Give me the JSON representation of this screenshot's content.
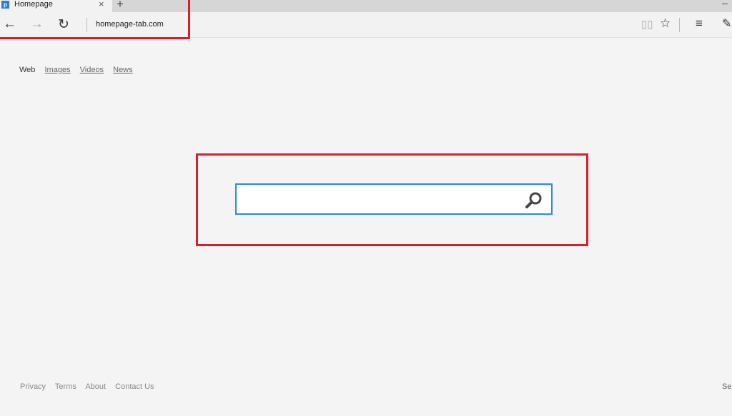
{
  "browser": {
    "tab_title": "Homepage",
    "favicon_letter": "p",
    "close_tab": "×",
    "new_tab": "+",
    "minimize": "–",
    "url": "homepage-tab.com"
  },
  "nav": {
    "items": [
      "Web",
      "Images",
      "Videos",
      "News"
    ],
    "active": "Web"
  },
  "search": {
    "value": "",
    "placeholder": ""
  },
  "footer": {
    "links": [
      "Privacy",
      "Terms",
      "About",
      "Contact Us"
    ],
    "settings": "Se"
  },
  "colors": {
    "annotation": "#d9202a",
    "search_border": "#2a8ae0",
    "background": "#f4f4f4"
  }
}
